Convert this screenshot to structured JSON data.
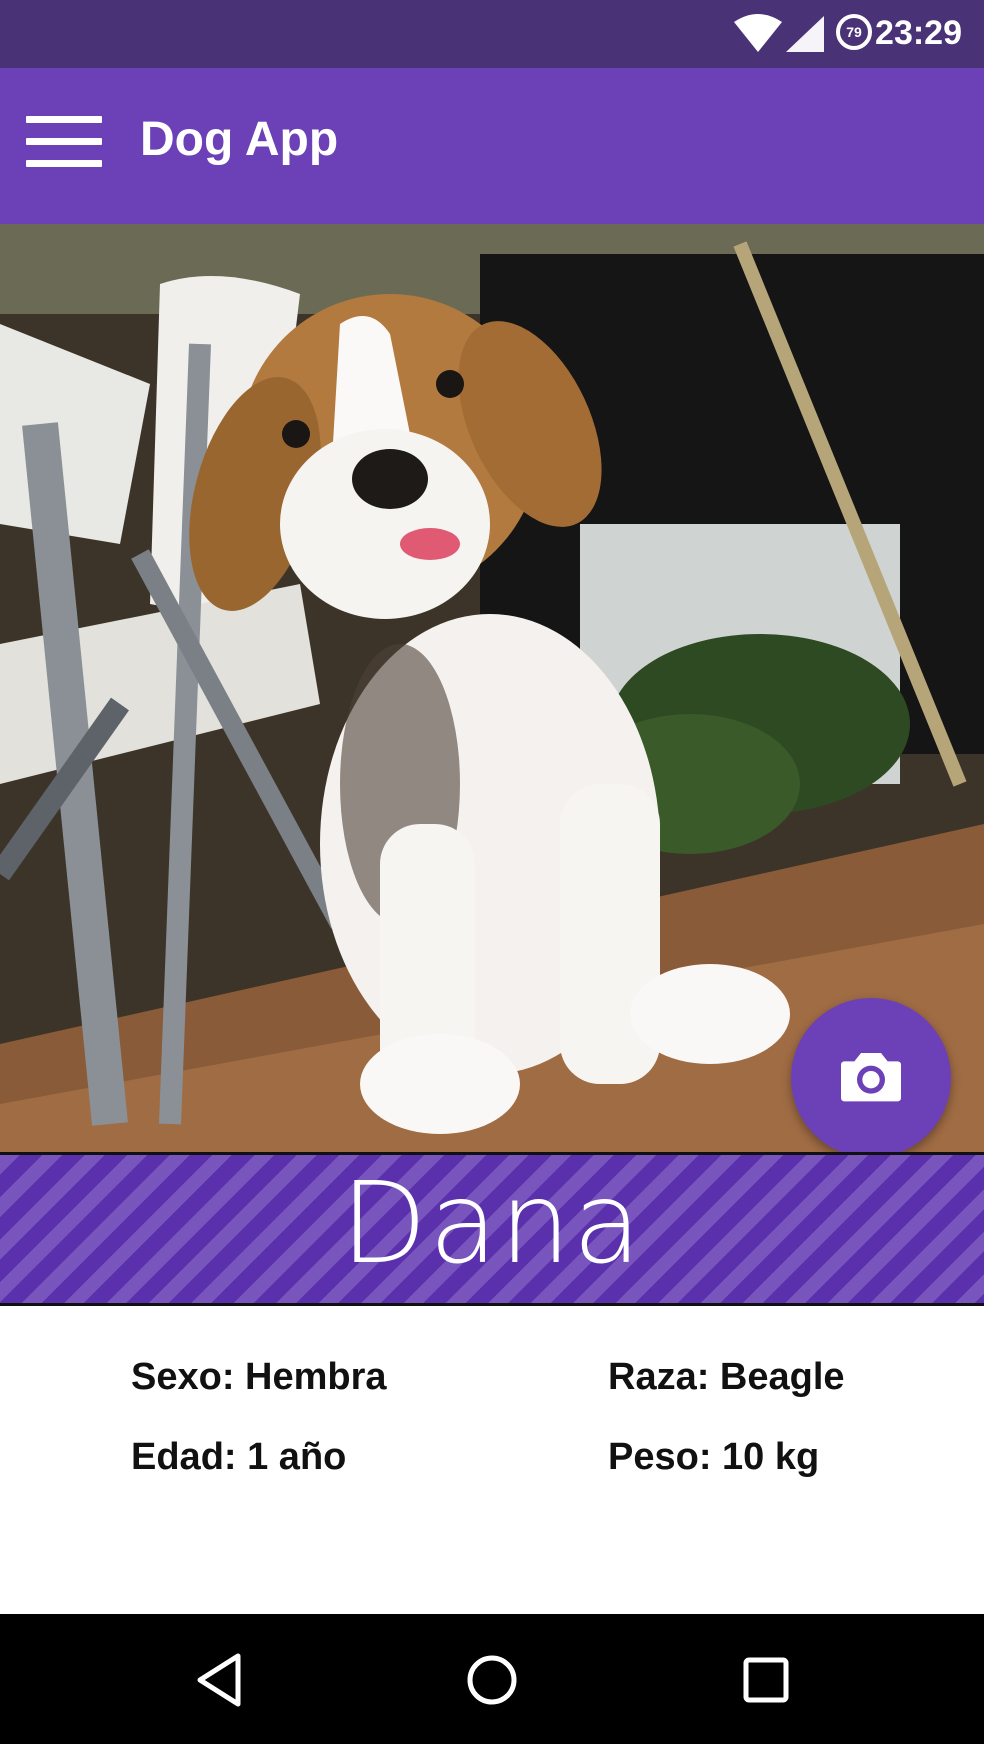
{
  "status_bar": {
    "time": "23:29",
    "battery_level": "79",
    "icons": [
      "wifi-icon",
      "cell-signal-icon",
      "battery-icon"
    ]
  },
  "app_bar": {
    "title": "Dog App",
    "menu_icon": "hamburger-menu-icon"
  },
  "hero": {
    "image_subject": "beagle puppy photo"
  },
  "fabs": {
    "camera_icon": "camera-icon",
    "gallery_icon": "image-file-icon",
    "camera_color": "#6c41b7",
    "gallery_color": "#ff8a00"
  },
  "dog": {
    "name": "Dana",
    "sex": "Sexo: Hembra",
    "breed": "Raza: Beagle",
    "age": "Edad: 1 año",
    "weight": "Peso: 10 kg"
  },
  "nav_bar": {
    "icons": [
      "back-icon",
      "home-icon",
      "recents-icon"
    ]
  },
  "colors": {
    "primary": "#6c41b7",
    "primary_dark": "#4a3276",
    "accent": "#ff8a00"
  }
}
